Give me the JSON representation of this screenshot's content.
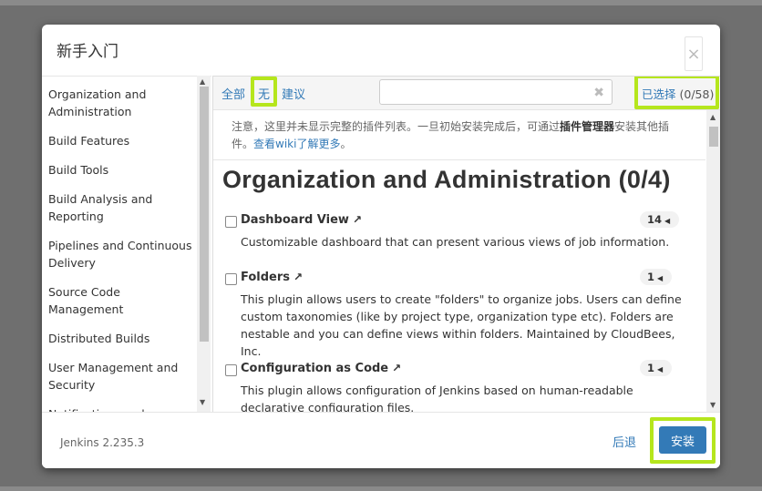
{
  "modal": {
    "title": "新手入门",
    "close_symbol": "×"
  },
  "sidebar": {
    "items": [
      {
        "label": "Organization and Administration"
      },
      {
        "label": "Build Features"
      },
      {
        "label": "Build Tools"
      },
      {
        "label": "Build Analysis and Reporting"
      },
      {
        "label": "Pipelines and Continuous Delivery"
      },
      {
        "label": "Source Code Management"
      },
      {
        "label": "Distributed Builds"
      },
      {
        "label": "User Management and Security"
      },
      {
        "label": "Notifications and..."
      }
    ]
  },
  "toolbar": {
    "all_label": "全部",
    "none_label": "无",
    "suggested_label": "建议",
    "search_value": "",
    "search_placeholder": "",
    "selected_label": "已选择",
    "selected_count": "(0/58)",
    "highlight_color": "#b5e61d"
  },
  "notice": {
    "text_before": "注意，这里并未显示完整的插件列表。一旦初始安装完成后，可通过",
    "bold_text": "插件管理器",
    "text_after": "安装其他插件。",
    "link_text": "查看wiki了解更多",
    "end": "。"
  },
  "category": {
    "title": "Organization and Administration (0/4)"
  },
  "plugins": [
    {
      "name": "Dashboard View",
      "deps": "14",
      "checked": false,
      "description": "Customizable dashboard that can present various views of job information."
    },
    {
      "name": "Folders",
      "deps": "1",
      "checked": false,
      "description": "This plugin allows users to create \"folders\" to organize jobs. Users can define custom taxonomies (like by project type, organization type etc). Folders are nestable and you can define views within folders. Maintained by CloudBees, Inc."
    },
    {
      "name": "Configuration as Code",
      "deps": "1",
      "checked": false,
      "description": "This plugin allows configuration of Jenkins based on human-readable declarative configuration files."
    }
  ],
  "footer": {
    "version": "Jenkins 2.235.3",
    "back_label": "后退",
    "install_label": "安装"
  },
  "colors": {
    "link": "#337ab7",
    "primary_button": "#337ab7",
    "highlight": "#b5e61d"
  }
}
